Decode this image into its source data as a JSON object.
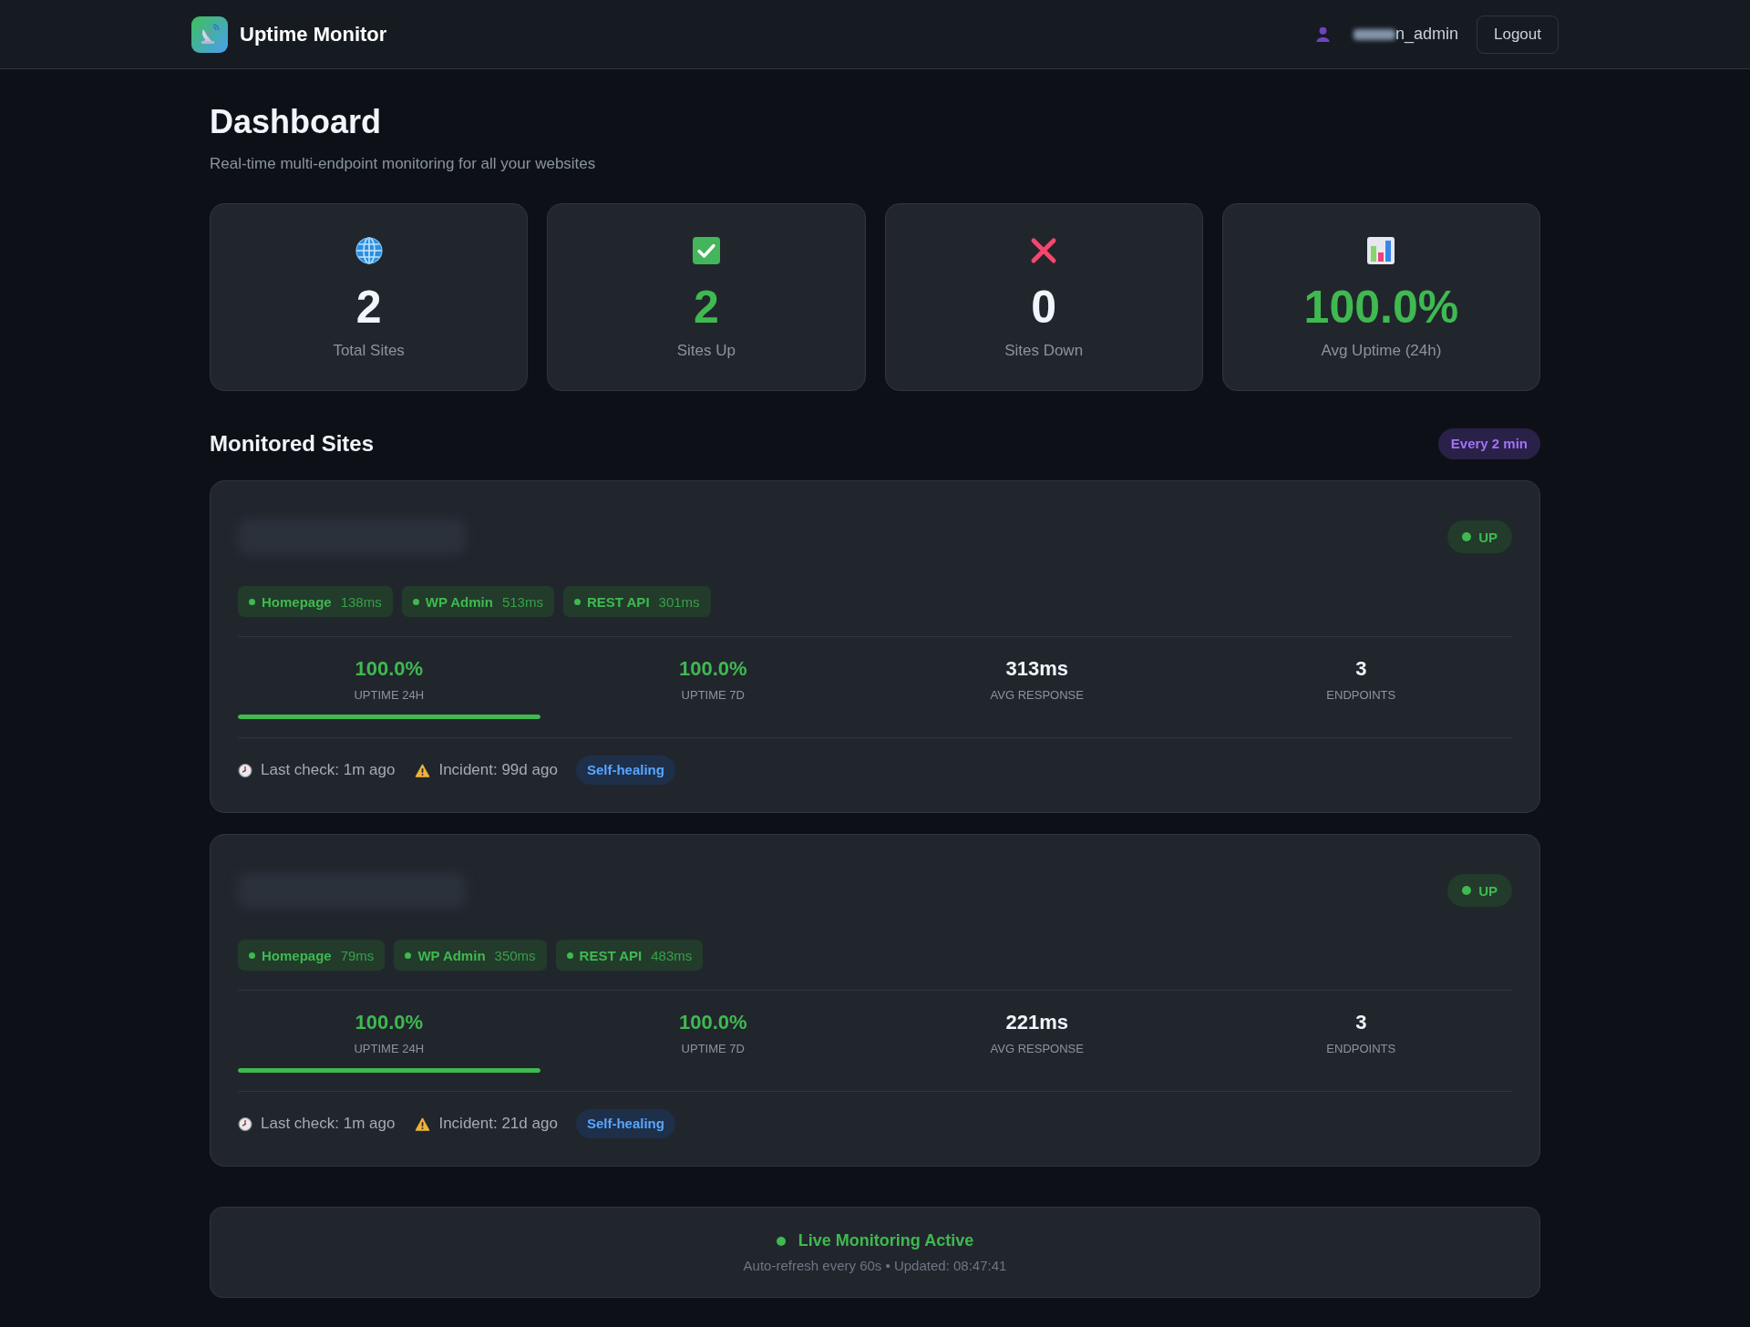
{
  "header": {
    "app_name": "Uptime Monitor",
    "user": {
      "name": "n_admin",
      "redacted_prefix": true
    },
    "logout": "Logout"
  },
  "page": {
    "title": "Dashboard",
    "subtitle": "Real-time multi-endpoint monitoring for all your websites"
  },
  "stats": [
    {
      "kind": "total",
      "value": "2",
      "label": "Total Sites"
    },
    {
      "kind": "up",
      "value": "2",
      "label": "Sites Up"
    },
    {
      "kind": "down",
      "value": "0",
      "label": "Sites Down"
    },
    {
      "kind": "uptime",
      "value": "100.0%",
      "label": "Avg Uptime (24h)"
    }
  ],
  "monitored_sites": {
    "title": "Monitored Sites",
    "interval": "Every 2 min",
    "sites": [
      {
        "title_redacted": true,
        "status": {
          "label": "UP",
          "kind": "up"
        },
        "endpoints": [
          {
            "name": "Homepage",
            "response": "138ms",
            "up": true
          },
          {
            "name": "WP Admin",
            "response": "513ms",
            "up": true
          },
          {
            "name": "REST API",
            "response": "301ms",
            "up": true
          }
        ],
        "metrics": [
          {
            "kind": "uptime",
            "value": "100.0%",
            "label": "UPTIME 24H",
            "level": 1.0
          },
          {
            "kind": "uptime",
            "value": "100.0%",
            "label": "UPTIME 7D"
          },
          {
            "kind": "plain",
            "value": "313ms",
            "label": "AVG RESPONSE"
          },
          {
            "kind": "plain",
            "value": "3",
            "label": "ENDPOINTS"
          }
        ],
        "last_check": "Last check: 1m ago",
        "incident": "Incident: 99d ago",
        "tag": "Self-healing"
      },
      {
        "title_redacted": true,
        "status": {
          "label": "UP",
          "kind": "up"
        },
        "endpoints": [
          {
            "name": "Homepage",
            "response": "79ms",
            "up": true
          },
          {
            "name": "WP Admin",
            "response": "350ms",
            "up": true
          },
          {
            "name": "REST API",
            "response": "483ms",
            "up": true
          }
        ],
        "metrics": [
          {
            "kind": "uptime",
            "value": "100.0%",
            "label": "UPTIME 24H",
            "level": 1.0
          },
          {
            "kind": "uptime",
            "value": "100.0%",
            "label": "UPTIME 7D"
          },
          {
            "kind": "plain",
            "value": "221ms",
            "label": "AVG RESPONSE"
          },
          {
            "kind": "plain",
            "value": "3",
            "label": "ENDPOINTS"
          }
        ],
        "last_check": "Last check: 1m ago",
        "incident": "Incident: 21d ago",
        "tag": "Self-healing"
      }
    ]
  },
  "live": {
    "active": true,
    "title": "Live Monitoring Active",
    "detail": "Auto-refresh every 60s • Updated: 08:47:41"
  }
}
